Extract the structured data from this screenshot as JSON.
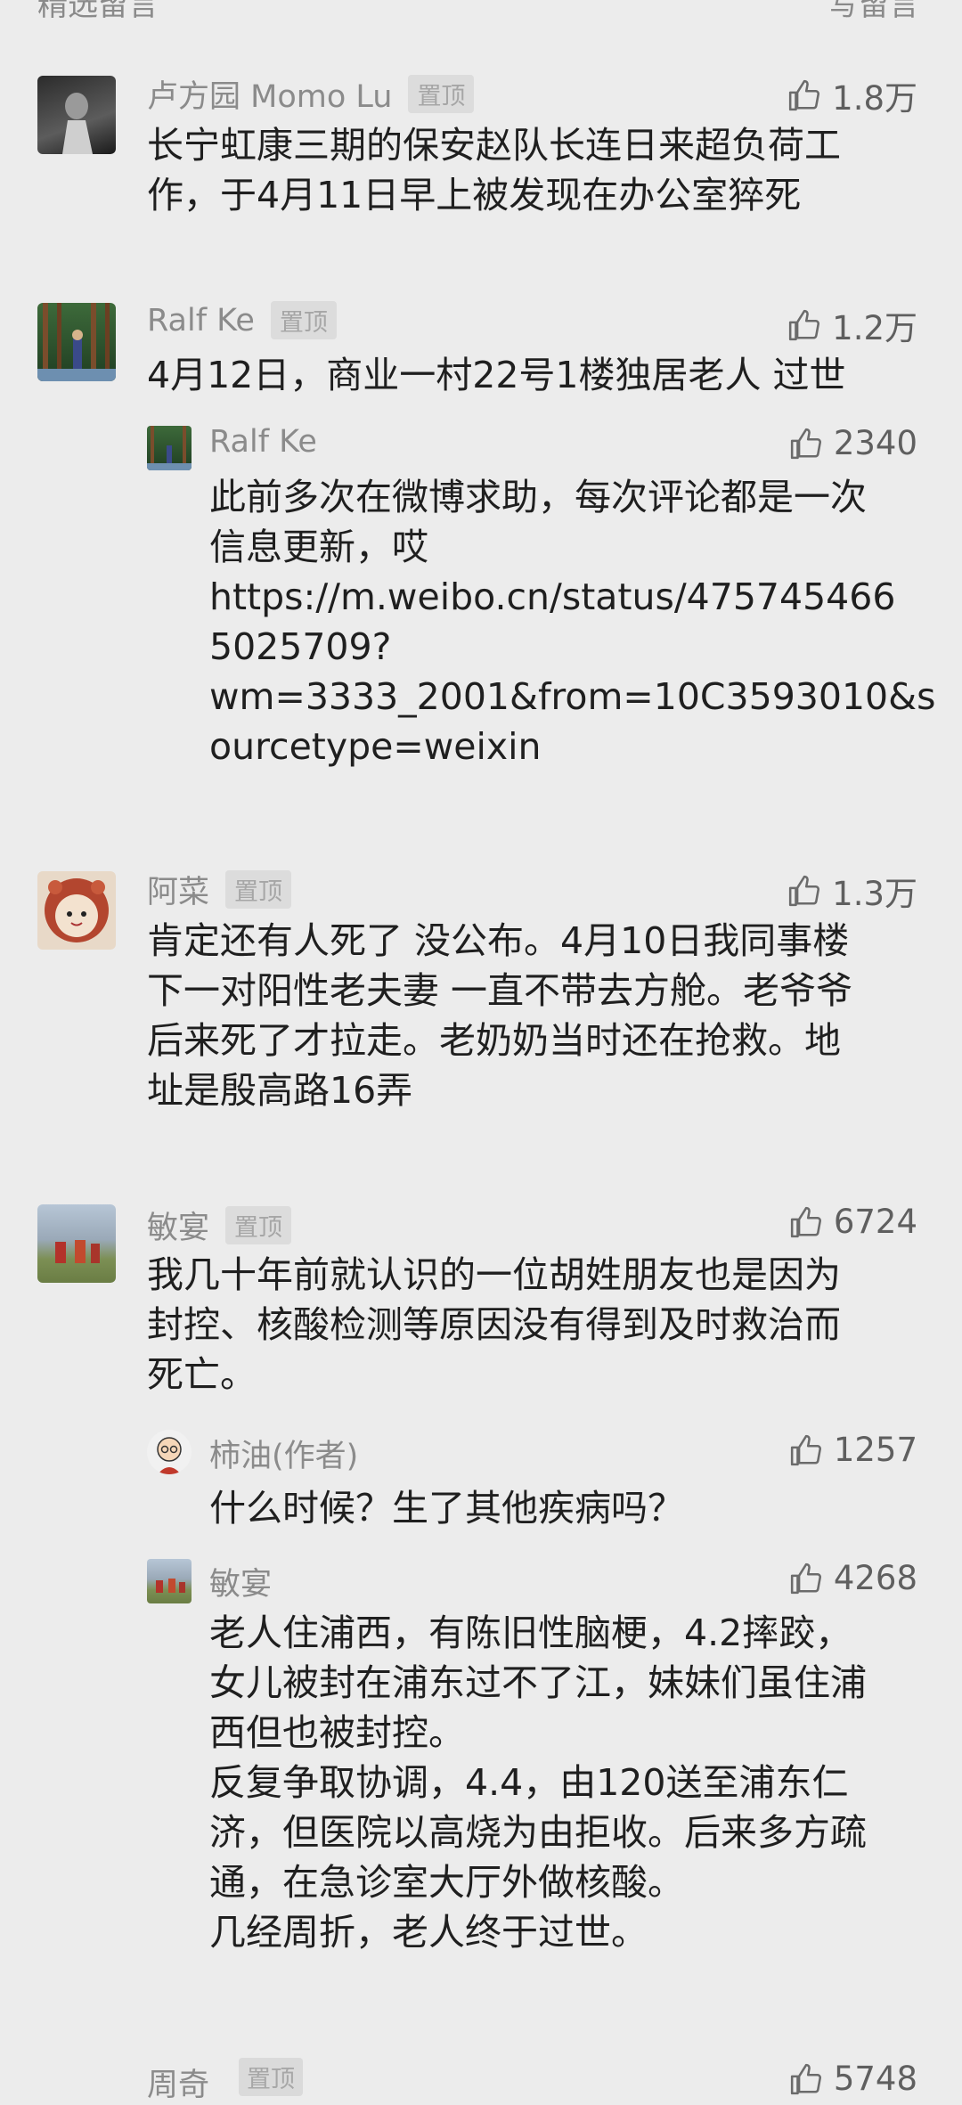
{
  "header_cut": {
    "left": "精选留言",
    "right": "写留言"
  },
  "comments": [
    {
      "name": "卢方园 Momo Lu",
      "pin": "置顶",
      "likes": "1.8万",
      "text": "长宁虹康三期的保安赵队长连日来超负荷工\n作，于4月11日早上被发现在办公室猝死"
    },
    {
      "name": "Ralf Ke",
      "pin": "置顶",
      "likes": "1.2万",
      "text": "4月12日，商业一村22号1楼独居老人 过世",
      "reply": {
        "name": "Ralf Ke",
        "likes": "2340",
        "text": "此前多次在微博求助，每次评论都是一次\n信息更新，哎\nhttps://m.weibo.cn/status/475745466\n5025709?\nwm=3333_2001&from=10C3593010&s\nourcetype=weixin"
      }
    },
    {
      "name": "阿菜",
      "pin": "置顶",
      "likes": "1.3万",
      "text": "肯定还有人死了 没公布。4月10日我同事楼\n下一对阳性老夫妻 一直不带去方舱。老爷爷\n后来死了才拉走。老奶奶当时还在抢救。地\n址是殷高路16弄"
    },
    {
      "name": "敏宴",
      "pin": "置顶",
      "likes": "6724",
      "text": "我几十年前就认识的一位胡姓朋友也是因为\n封控、核酸检测等原因没有得到及时救治而\n死亡。",
      "reply1": {
        "name": "柿油(作者)",
        "likes": "1257",
        "text": "什么时候？生了其他疾病吗？"
      },
      "reply2": {
        "name": "敏宴",
        "likes": "4268",
        "text": "老人住浦西，有陈旧性脑梗，4.2摔跤，\n女儿被封在浦东过不了江，妹妹们虽住浦\n西但也被封控。\n反复争取协调，4.4，由120送至浦东仁\n济，但医院以高烧为由拒收。后来多方疏\n通，在急诊室大厅外做核酸。\n几经周折，老人终于过世。"
      }
    }
  ],
  "footer_cut": {
    "name": "周奇",
    "pin": "置顶",
    "likes": "5748"
  }
}
